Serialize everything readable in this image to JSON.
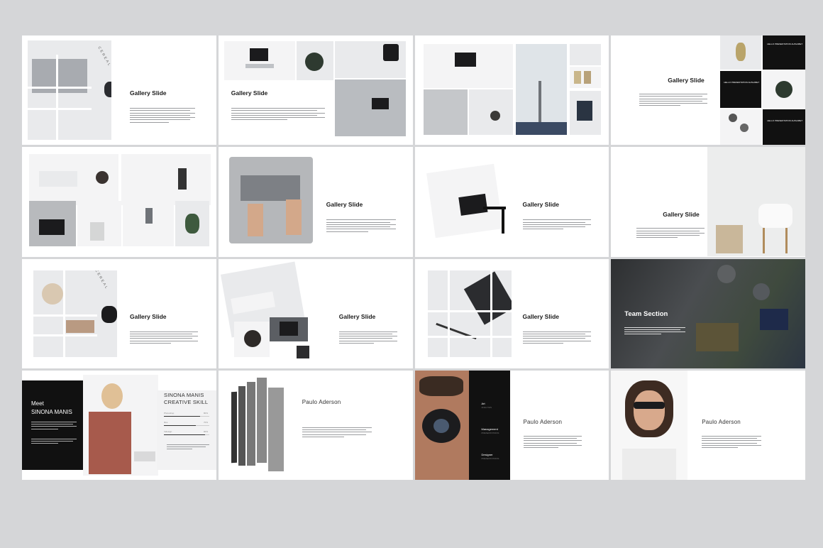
{
  "slides": {
    "s1": {
      "title": "Gallery Slide",
      "overlay": "CEREAL"
    },
    "s2": {
      "title": "Gallery Slide"
    },
    "s3": {},
    "s4": {
      "title": "Gallery Slide",
      "label_top": "HELLO PRESENTATION ALPHABET",
      "label_mid": "HELLO PRESENTATION ALPHABET",
      "label_bot": "HELLO PRESENTATION ALPHABET"
    },
    "s5": {},
    "s6": {
      "title": "Gallery Slide"
    },
    "s7": {
      "title": "Gallery Slide"
    },
    "s8": {
      "title": "Gallery Slide"
    },
    "s9": {
      "title": "Gallery Slide",
      "overlay": "CEREAL"
    },
    "s10": {
      "title": "Gallery Slide"
    },
    "s11": {
      "title": "Gallery Slide"
    },
    "s12": {
      "title": "Team Section"
    },
    "s13": {
      "meet": "Meet",
      "name": "SINONA MANIS",
      "skill_title_1": "SINONA MANIS",
      "skill_title_2": "CREATIVE SKILL",
      "skills": [
        {
          "label": "Photoshop",
          "value": "80%",
          "level": 0.8
        },
        {
          "label": "Illus",
          "value": "70%",
          "level": 0.7
        },
        {
          "label": "Indesign",
          "value": "90%",
          "level": 0.9
        }
      ]
    },
    "s14": {
      "name": "Paulo Aderson"
    },
    "s15": {
      "name": "Paulo Aderson",
      "roles": [
        {
          "title": "Art",
          "sub": "ANALYSIS"
        },
        {
          "title": "Management",
          "sub": "PRESENTATIONS"
        },
        {
          "title": "Designer",
          "sub": "PRESENTATIONS"
        }
      ]
    },
    "s16": {
      "name": "Paulo Aderson"
    }
  },
  "colors": {
    "background": "#d5d6d8",
    "slide": "#ffffff",
    "dark": "#111111"
  }
}
